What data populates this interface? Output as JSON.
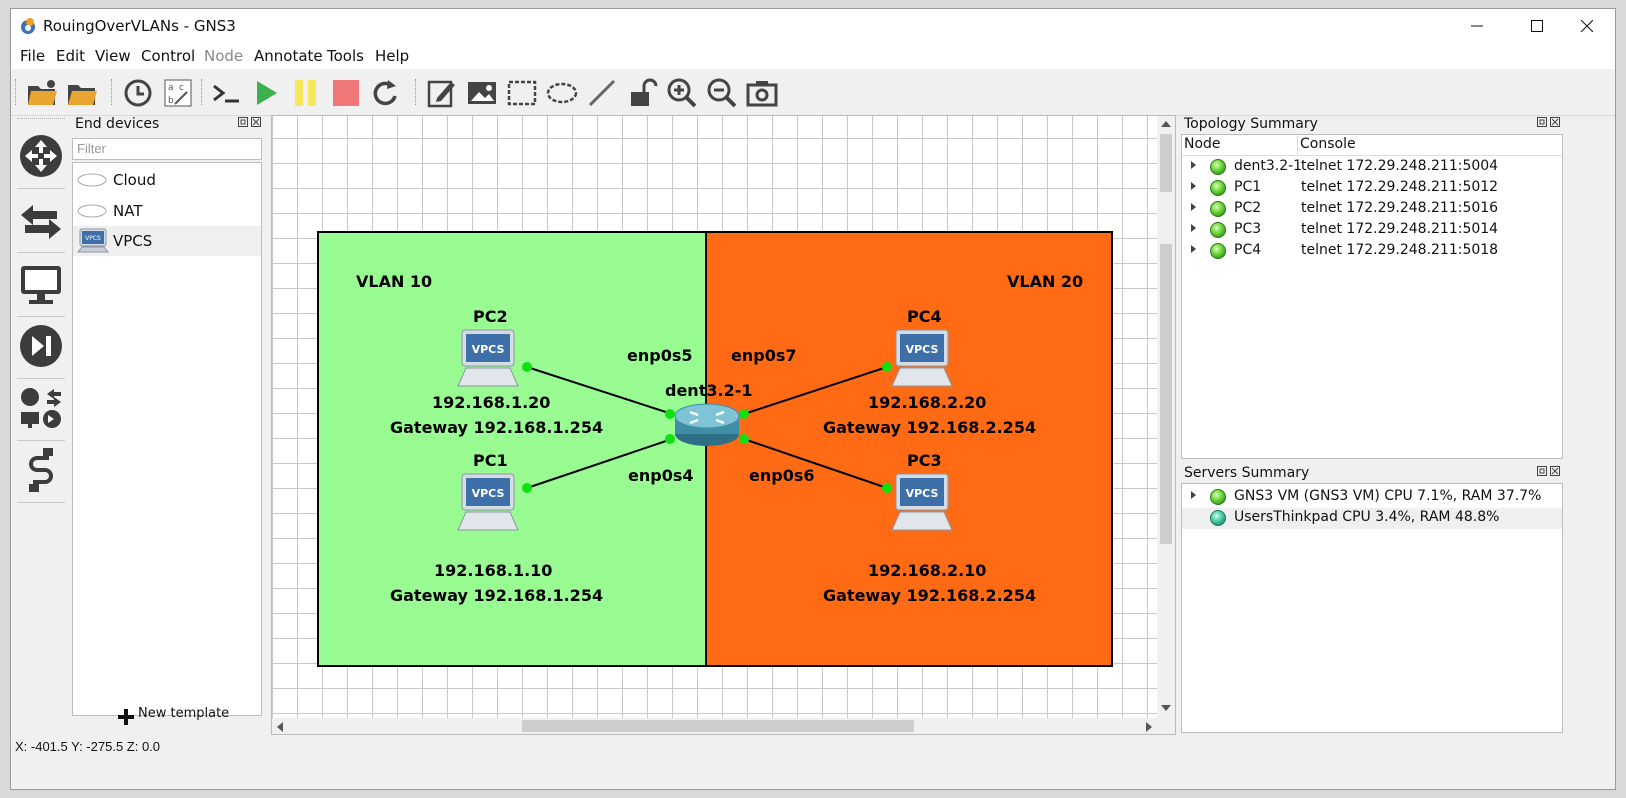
{
  "window": {
    "title": "RouingOverVLANs - GNS3"
  },
  "menu": [
    "File",
    "Edit",
    "View",
    "Control",
    "Node",
    "Annotate",
    "Tools",
    "Help"
  ],
  "end_devices": {
    "title": "End devices",
    "filter_placeholder": "Filter",
    "items": [
      "Cloud",
      "NAT",
      "VPCS"
    ],
    "vpcs_icon_text": "VPCS",
    "new_template": "New template"
  },
  "topology": {
    "vlan10_label": "VLAN 10",
    "vlan20_label": "VLAN 20",
    "vlan10_color": "#98fc93",
    "vlan20_color": "#ff6a14",
    "router_name": "dent3.2-1",
    "pc2": {
      "name": "PC2",
      "ip": "192.168.1.20",
      "gateway": "Gateway 192.168.1.254"
    },
    "pc1": {
      "name": "PC1",
      "ip": "192.168.1.10",
      "gateway": "Gateway 192.168.1.254"
    },
    "pc4": {
      "name": "PC4",
      "ip": "192.168.2.20",
      "gateway": "Gateway 192.168.2.254"
    },
    "pc3": {
      "name": "PC3",
      "ip": "192.168.2.10",
      "gateway": "Gateway 192.168.2.254"
    },
    "iface_pc2": "enp0s5",
    "iface_pc1": "enp0s4",
    "iface_pc4": "enp0s7",
    "iface_pc3": "enp0s6",
    "vpcs_text": "VPCS"
  },
  "topology_summary": {
    "title": "Topology Summary",
    "col_node": "Node",
    "col_console": "Console",
    "rows": [
      {
        "node": "dent3.2-1",
        "console": "telnet 172.29.248.211:5004"
      },
      {
        "node": "PC1",
        "console": "telnet 172.29.248.211:5012"
      },
      {
        "node": "PC2",
        "console": "telnet 172.29.248.211:5016"
      },
      {
        "node": "PC3",
        "console": "telnet 172.29.248.211:5014"
      },
      {
        "node": "PC4",
        "console": "telnet 172.29.248.211:5018"
      }
    ]
  },
  "servers_summary": {
    "title": "Servers Summary",
    "rows": [
      "GNS3 VM (GNS3 VM) CPU 7.1%, RAM 37.7%",
      "UsersThinkpad CPU 3.4%, RAM 48.8%"
    ]
  },
  "status_bar": "X: -401.5 Y: -275.5 Z: 0.0"
}
